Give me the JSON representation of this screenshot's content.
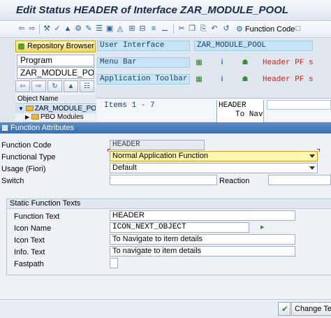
{
  "window": {
    "title": "Edit Status HEADER of Interface ZAR_MODULE_POOL"
  },
  "toolbar": {
    "function_code_label": "Function Code",
    "icons": [
      "back-icon",
      "forward-icon",
      "other-object-icon",
      "check-icon",
      "activate-icon",
      "test-icon",
      "where-used-icon",
      "edit-icon",
      "display-change-icon",
      "navigate-icon",
      "expand-icon",
      "collapse-icon",
      "insert-icon",
      "delete-icon",
      "cut-icon",
      "copy-icon",
      "paste-icon",
      "undo-icon",
      "help-icon"
    ]
  },
  "repository": {
    "button_label": "Repository Browser",
    "object_type": "Program",
    "object_name": "ZAR_MODULE_POOL",
    "column_header": "Object Name",
    "tree": [
      {
        "label": "ZAR_MODULE_POOL"
      },
      {
        "label": "PBO Modules"
      }
    ]
  },
  "interface": {
    "rows": [
      {
        "label": "User Interface",
        "value": "ZAR_MODULE_POOL"
      },
      {
        "label": "Menu Bar",
        "value": "Header PF s"
      },
      {
        "label": "Application Toolbar",
        "value": "Header PF s"
      }
    ],
    "items_label": "Items  1 -  7",
    "item_code": "HEADER",
    "item_text": "To Nav"
  },
  "dialog": {
    "title": "Function Attributes",
    "fields": {
      "function_code": {
        "label": "Function Code",
        "value": "HEADER"
      },
      "functional_type": {
        "label": "Functional Type",
        "value": "Normal Application Function"
      },
      "usage": {
        "label": "Usage (Fiori)",
        "value": "Default"
      },
      "switch": {
        "label": "Switch",
        "value": ""
      },
      "reaction": {
        "label": "Reaction",
        "value": ""
      }
    },
    "static_texts": {
      "group_title": "Static Function Texts",
      "function_text": {
        "label": "Function Text",
        "value": "HEADER"
      },
      "icon_name": {
        "label": "Icon Name",
        "value": "ICON_NEXT_OBJECT"
      },
      "icon_text": {
        "label": "Icon Text",
        "value": "To Navigate to item details"
      },
      "info_text": {
        "label": "Info. Text",
        "value": "To navigate to item details"
      },
      "fastpath": {
        "label": "Fastpath",
        "value": ""
      }
    },
    "buttons": {
      "change_text": "Change Text"
    }
  },
  "colors": {
    "dialog_bar": "#3b6eae",
    "selected_field": "#fff7b0",
    "required_marker": "#c8201c",
    "interface_label_bg": "#c6e4f5"
  }
}
